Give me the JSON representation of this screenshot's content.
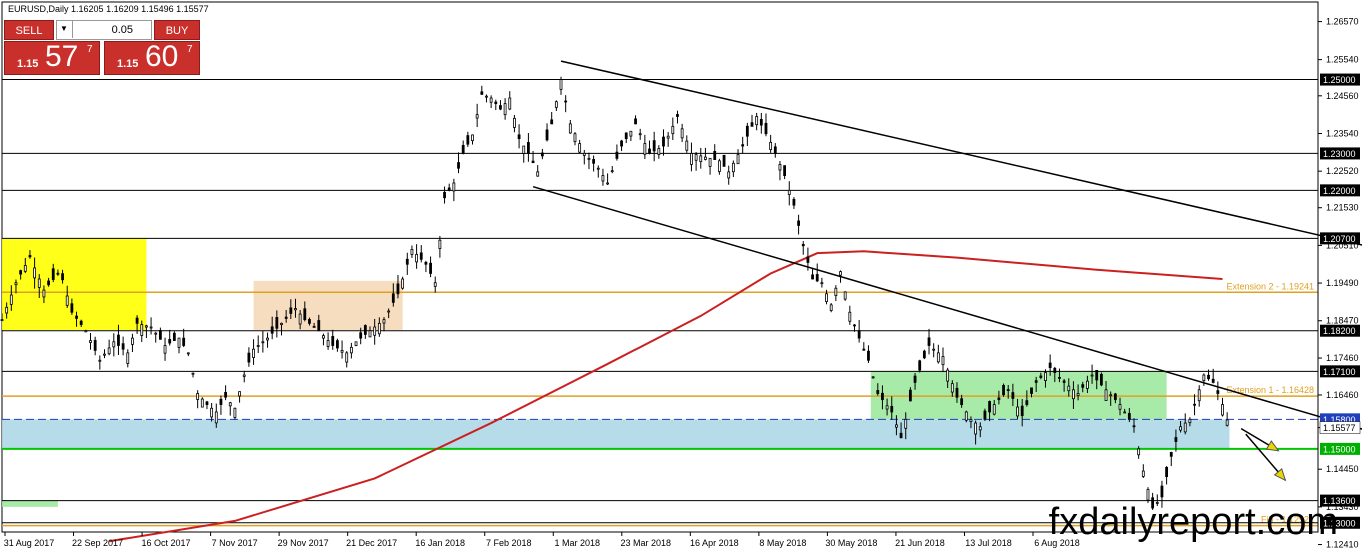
{
  "header": {
    "symbol": "EURUSD,Daily",
    "ohlc": "1.16205 1.16209 1.15496 1.15577"
  },
  "trade_panel": {
    "sell_label": "SELL",
    "buy_label": "BUY",
    "lot_value": "0.05",
    "sell_price_prefix": "1.15",
    "sell_price_big": "57",
    "sell_price_sup": "7",
    "buy_price_prefix": "1.15",
    "buy_price_big": "60",
    "buy_price_sup": "7"
  },
  "watermark": "fxdailyreport.com",
  "chart_data": {
    "type": "candlestick",
    "title": "EURUSD,Daily",
    "ylim": [
      1.1275,
      1.271
    ],
    "price_ticks": [
      "1.26570",
      "1.25540",
      "1.24560",
      "1.23540",
      "1.22520",
      "1.21530",
      "1.20510",
      "1.19490",
      "1.18470",
      "1.17460",
      "1.16460",
      "1.15577",
      "1.14450",
      "1.13430",
      "1.12410"
    ],
    "date_ticks": [
      "31 Aug 2017",
      "22 Sep 2017",
      "16 Oct 2017",
      "7 Nov 2017",
      "29 Nov 2017",
      "21 Dec 2017",
      "16 Jan 2018",
      "7 Feb 2018",
      "1 Mar 2018",
      "23 Mar 2018",
      "16 Apr 2018",
      "8 May 2018",
      "30 May 2018",
      "21 Jun 2018",
      "13 Jul 2018",
      "6 Aug 2018"
    ],
    "horizontal_levels": [
      {
        "label": "1.25000",
        "value": 1.25,
        "color": "#000000",
        "style": "solid"
      },
      {
        "label": "1.23000",
        "value": 1.23,
        "color": "#000000",
        "style": "solid"
      },
      {
        "label": "1.22000",
        "value": 1.22,
        "color": "#000000",
        "style": "solid"
      },
      {
        "label": "1.20700",
        "value": 1.207,
        "color": "#000000",
        "style": "solid"
      },
      {
        "label": "1.18200",
        "value": 1.182,
        "color": "#000000",
        "style": "solid"
      },
      {
        "label": "1.17100",
        "value": 1.171,
        "color": "#000000",
        "style": "solid"
      },
      {
        "label": "1.15800",
        "value": 1.158,
        "color": "#1f3fbf",
        "style": "dashed"
      },
      {
        "label": "1.15000",
        "value": 1.15,
        "color": "#00c800",
        "style": "solid"
      },
      {
        "label": "1.13600",
        "value": 1.136,
        "color": "#000000",
        "style": "solid"
      },
      {
        "label": "1.13000",
        "value": 1.13,
        "color": "#000000",
        "style": "solid"
      }
    ],
    "fib_levels": [
      {
        "label": "Extension 2 - 1.19241",
        "value": 1.19241,
        "color": "#e0a020"
      },
      {
        "label": "Extension 1 - 1.16428",
        "value": 1.16428,
        "color": "#e0a020"
      },
      {
        "label": "Fib - 1.12922",
        "value": 1.12922,
        "color": "#e0a020"
      }
    ],
    "current_price": {
      "label": "1.15577",
      "value": 1.15577
    },
    "zones": [
      {
        "color": "#ffff00",
        "t0": 0,
        "t1": 62,
        "y0": 1.1822,
        "y1": 1.207
      },
      {
        "color": "#f5d9b8",
        "t0": 108,
        "t1": 172,
        "y0": 1.1822,
        "y1": 1.1955
      },
      {
        "color": "#9fe89f",
        "t0": 373,
        "t1": 500,
        "y0": 1.158,
        "y1": 1.171
      },
      {
        "color": "#add8e6",
        "t0": 0,
        "t1": 527,
        "y0": 1.15,
        "y1": 1.158
      },
      {
        "color": "#9fe89f",
        "t0": 0,
        "t1": 24,
        "y0": 1.1343,
        "y1": 1.136
      }
    ],
    "trendlines": [
      {
        "points": [
          [
            240,
            1.255
          ],
          [
            651,
            1.1955
          ]
        ],
        "color": "#000000"
      },
      {
        "points": [
          [
            228,
            1.221
          ],
          [
            651,
            1.143
          ]
        ],
        "color": "#000000"
      }
    ],
    "moving_average": {
      "color": "#cc2020",
      "points": [
        [
          46,
          1.125
        ],
        [
          100,
          1.1305
        ],
        [
          160,
          1.142
        ],
        [
          210,
          1.157
        ],
        [
          260,
          1.173
        ],
        [
          300,
          1.186
        ],
        [
          330,
          1.1975
        ],
        [
          350,
          1.203
        ],
        [
          370,
          1.2035
        ],
        [
          410,
          1.2018
        ],
        [
          470,
          1.1985
        ],
        [
          524,
          1.196
        ]
      ]
    },
    "projection_arrows": [
      {
        "from": [
          532,
          1.1555
        ],
        "to": [
          548,
          1.1495
        ],
        "color": "#e8d800"
      },
      {
        "from": [
          534,
          1.154
        ],
        "to": [
          551,
          1.1415
        ],
        "color": "#e8d800"
      }
    ],
    "price_path": [
      [
        0,
        1.185
      ],
      [
        6,
        1.195
      ],
      [
        12,
        1.202
      ],
      [
        18,
        1.193
      ],
      [
        25,
        1.198
      ],
      [
        30,
        1.187
      ],
      [
        36,
        1.182
      ],
      [
        42,
        1.174
      ],
      [
        48,
        1.179
      ],
      [
        54,
        1.176
      ],
      [
        58,
        1.184
      ],
      [
        64,
        1.183
      ],
      [
        70,
        1.178
      ],
      [
        76,
        1.18
      ],
      [
        80,
        1.176
      ],
      [
        84,
        1.165
      ],
      [
        88,
        1.162
      ],
      [
        92,
        1.16
      ],
      [
        96,
        1.164
      ],
      [
        100,
        1.161
      ],
      [
        104,
        1.17
      ],
      [
        108,
        1.177
      ],
      [
        114,
        1.18
      ],
      [
        120,
        1.184
      ],
      [
        126,
        1.188
      ],
      [
        130,
        1.185
      ],
      [
        136,
        1.182
      ],
      [
        142,
        1.178
      ],
      [
        148,
        1.176
      ],
      [
        152,
        1.179
      ],
      [
        158,
        1.182
      ],
      [
        164,
        1.185
      ],
      [
        170,
        1.192
      ],
      [
        176,
        1.204
      ],
      [
        182,
        1.2
      ],
      [
        186,
        1.195
      ],
      [
        190,
        1.218
      ],
      [
        194,
        1.222
      ],
      [
        198,
        1.23
      ],
      [
        202,
        1.235
      ],
      [
        206,
        1.246
      ],
      [
        210,
        1.245
      ],
      [
        214,
        1.242
      ],
      [
        218,
        1.245
      ],
      [
        222,
        1.234
      ],
      [
        226,
        1.23
      ],
      [
        230,
        1.225
      ],
      [
        236,
        1.238
      ],
      [
        240,
        1.25
      ],
      [
        244,
        1.238
      ],
      [
        250,
        1.23
      ],
      [
        256,
        1.226
      ],
      [
        260,
        1.222
      ],
      [
        266,
        1.232
      ],
      [
        272,
        1.238
      ],
      [
        278,
        1.23
      ],
      [
        284,
        1.232
      ],
      [
        290,
        1.24
      ],
      [
        296,
        1.23
      ],
      [
        302,
        1.229
      ],
      [
        308,
        1.228
      ],
      [
        312,
        1.225
      ],
      [
        318,
        1.232
      ],
      [
        324,
        1.24
      ],
      [
        330,
        1.233
      ],
      [
        336,
        1.224
      ],
      [
        340,
        1.216
      ],
      [
        344,
        1.205
      ],
      [
        348,
        1.196
      ],
      [
        352,
        1.195
      ],
      [
        356,
        1.189
      ],
      [
        360,
        1.198
      ],
      [
        364,
        1.187
      ],
      [
        368,
        1.18
      ],
      [
        372,
        1.174
      ],
      [
        376,
        1.165
      ],
      [
        382,
        1.16
      ],
      [
        386,
        1.153
      ],
      [
        392,
        1.168
      ],
      [
        398,
        1.178
      ],
      [
        404,
        1.175
      ],
      [
        410,
        1.164
      ],
      [
        416,
        1.158
      ],
      [
        420,
        1.156
      ],
      [
        426,
        1.162
      ],
      [
        432,
        1.166
      ],
      [
        438,
        1.159
      ],
      [
        444,
        1.168
      ],
      [
        450,
        1.172
      ],
      [
        456,
        1.168
      ],
      [
        462,
        1.165
      ],
      [
        468,
        1.17
      ],
      [
        474,
        1.166
      ],
      [
        480,
        1.162
      ],
      [
        486,
        1.156
      ],
      [
        490,
        1.144
      ],
      [
        494,
        1.134
      ],
      [
        498,
        1.137
      ],
      [
        502,
        1.148
      ],
      [
        506,
        1.156
      ],
      [
        510,
        1.158
      ],
      [
        516,
        1.17
      ],
      [
        520,
        1.168
      ],
      [
        524,
        1.162
      ],
      [
        527,
        1.15577
      ]
    ],
    "gridlines": false
  }
}
